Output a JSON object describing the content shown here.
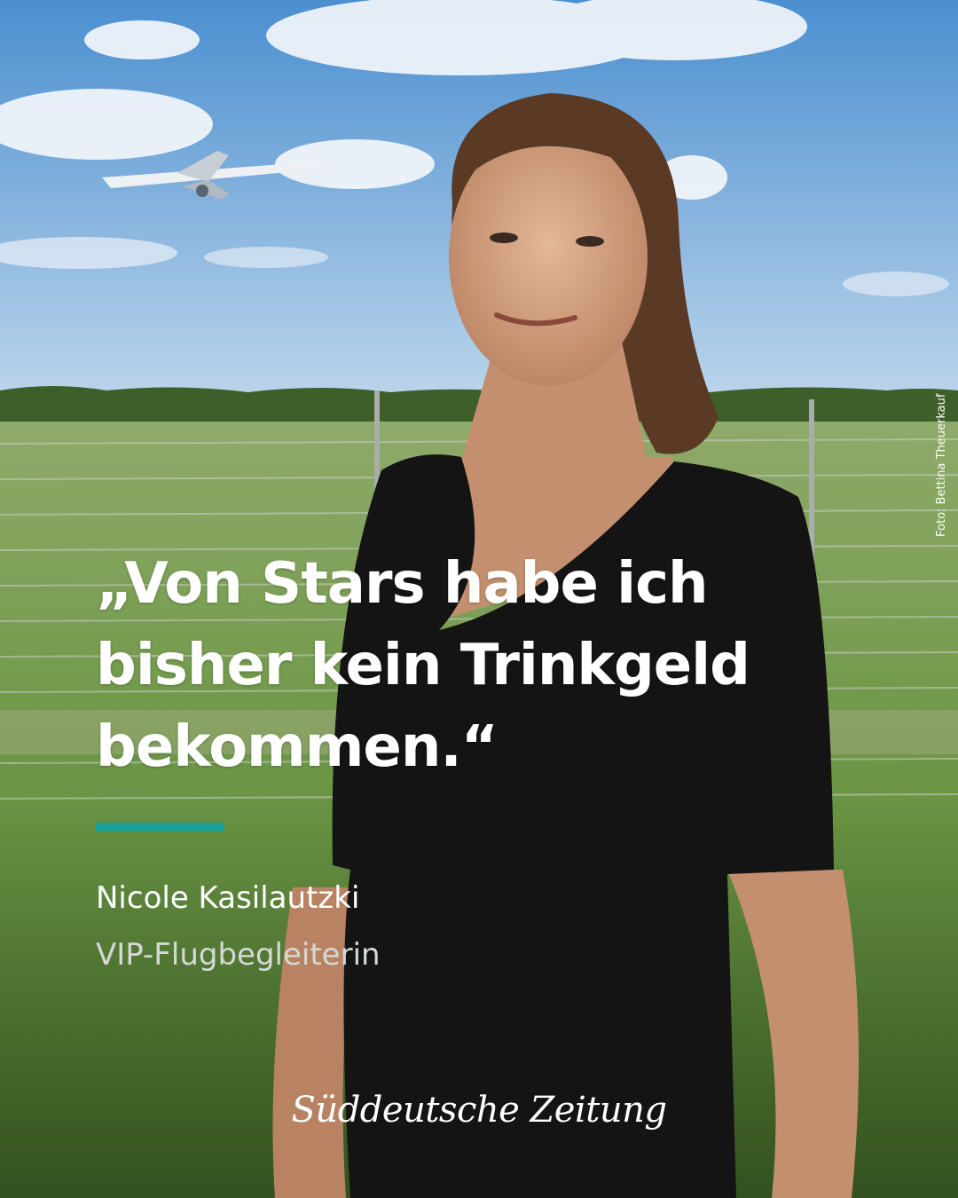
{
  "post": {
    "quote_lines": [
      "„Von Stars habe ich",
      "bisher kein Trinkgeld",
      "bekommen.“"
    ],
    "person_name": "Nicole Kasilautzki",
    "person_role": "VIP-Flugbegleiterin",
    "photo_credit": "Foto: Bettina Theuerkauf",
    "brand_logo": "Süddeutsche Zeitung",
    "accent_color": "#1a9e98"
  },
  "photo": {
    "sky_top": "#4b8fd0",
    "sky_bottom": "#b9d3ea",
    "grass": "#5f8f3e",
    "dress": "#141414",
    "hair": "#5a3a25",
    "skin": "#d9a887"
  }
}
